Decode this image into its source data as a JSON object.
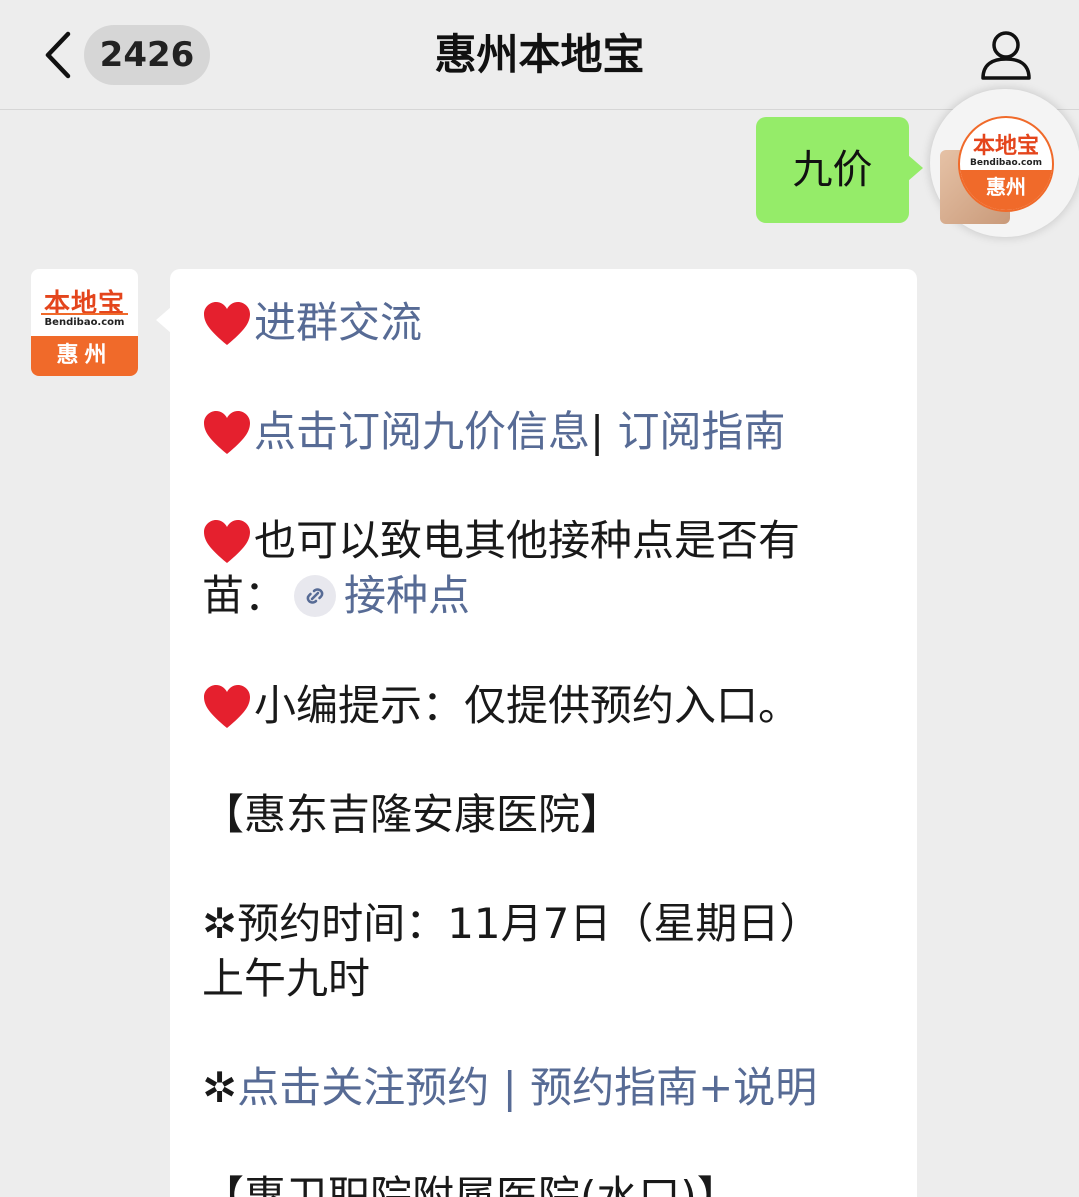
{
  "header": {
    "back_label": "返回",
    "unread_count": "2426",
    "title": "惠州本地宝"
  },
  "outgoing": {
    "text": "九价"
  },
  "brand": {
    "logo_text": "本地宝",
    "logo_url": "Bendibao.com",
    "logo_city": "惠州",
    "accent_color": "#f06a2a",
    "link_color": "#576b95",
    "bubble_green": "#95ec69"
  },
  "message": {
    "item1_link": "进群交流",
    "item2_link_a": "点击订阅九价信息",
    "item2_sep": "|",
    "item2_link_b": " 订阅指南",
    "item3_text_a": "也可以致电其他接种点是否有",
    "item3_text_b": "苗：",
    "item3_link": "接种点",
    "item4_text": "小编提示：仅提供预约入口。",
    "hospital1": "【惠东吉隆安康医院】",
    "time_label": "✲预约时间：11月7日（星期日）",
    "time_rest": "上午九时",
    "star": "✲",
    "link_follow": "点击关注预约",
    "link_sep": " | ",
    "link_guide": "预约指南+说明",
    "hospital2_partial": "【惠卫职院附属医院(水口)】"
  }
}
